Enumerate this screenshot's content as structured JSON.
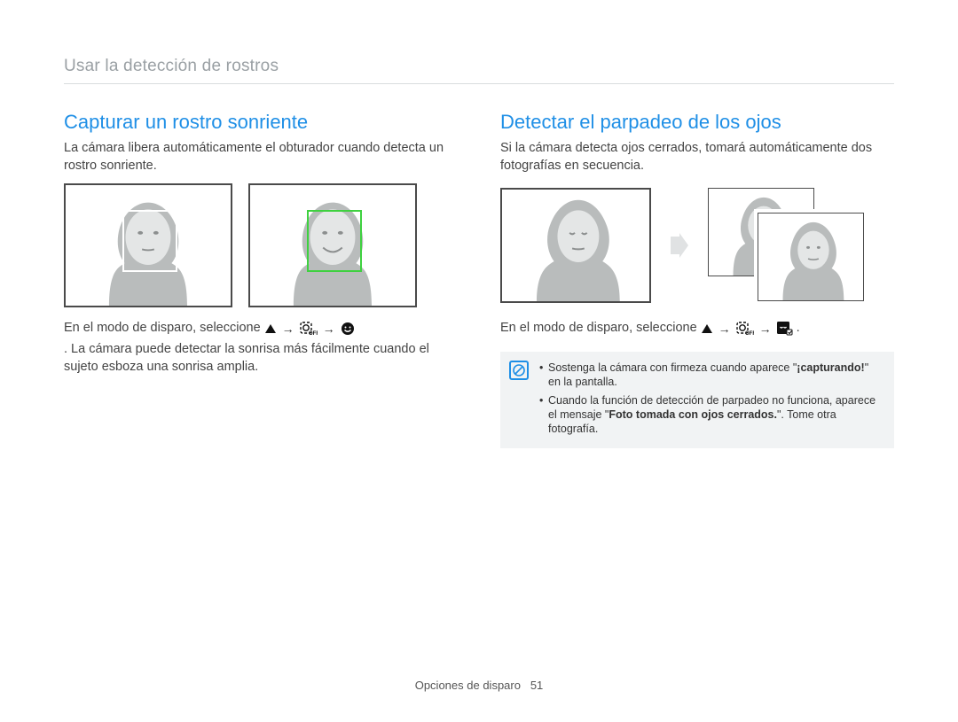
{
  "breadcrumb": "Usar la detección de rostros",
  "left": {
    "heading": "Capturar un rostro sonriente",
    "intro": "La cámara libera automáticamente el obturador cuando detecta un rostro sonriente.",
    "sel_prefix": "En el modo de disparo, seleccione",
    "sel_suffix": ". La cámara puede detectar la sonrisa más fácilmente cuando el sujeto esboza una sonrisa amplia."
  },
  "right": {
    "heading": "Detectar el parpadeo de los ojos",
    "intro": "Si la cámara detecta ojos cerrados, tomará automáticamente dos fotografías en secuencia.",
    "sel_prefix": "En el modo de disparo, seleccione",
    "note": {
      "item1_a": "Sostenga la cámara con firmeza cuando aparece \"",
      "item1_b": "¡capturando!",
      "item1_c": "\" en la pantalla.",
      "item2_a": "Cuando la función de detección de parpadeo no funciona, aparece el mensaje \"",
      "item2_b": "Foto tomada con ojos cerrados.",
      "item2_c": "\". Tome otra fotografía."
    }
  },
  "arrow": "→",
  "dot": ".",
  "footer_label": "Opciones de disparo",
  "footer_page": "51"
}
